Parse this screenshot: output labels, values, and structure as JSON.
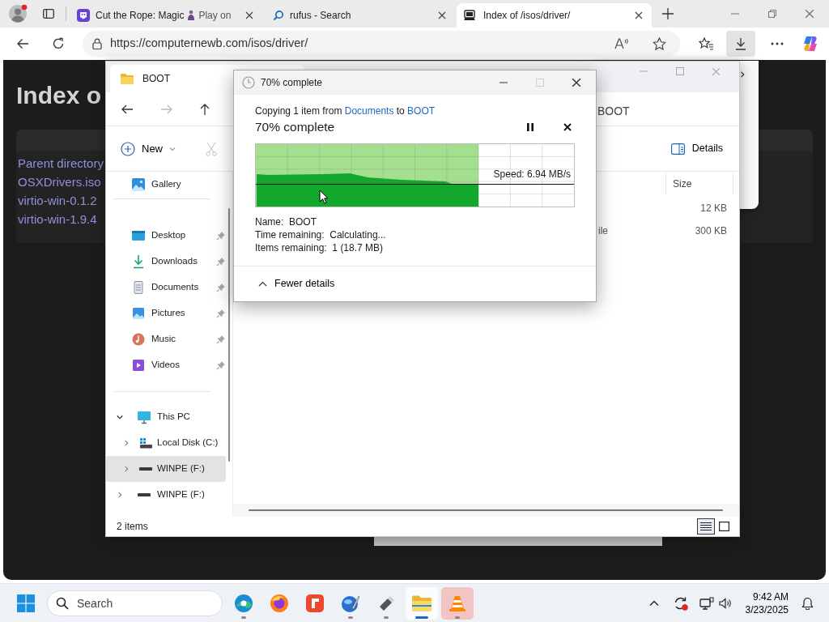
{
  "browser": {
    "tabs": [
      {
        "title": "Cut the Rope: Magic",
        "title_after_icon": "Play on",
        "selected": false
      },
      {
        "title": "rufus - Search",
        "selected": false
      },
      {
        "title": "Index of /isos/driver/",
        "selected": true
      }
    ],
    "address": "https://computernewb.com/isos/driver/"
  },
  "web_page": {
    "heading": "Index o",
    "links": [
      "Parent directory",
      "OSXDrivers.iso",
      "virtio-win-0.1.2",
      "virtio-win-1.9.4"
    ]
  },
  "explorer": {
    "tab_title": "BOOT",
    "breadcrumb": "BOOT",
    "new_label": "New",
    "cut_disabled": true,
    "details_label": "Details",
    "sidebar": {
      "top": [
        {
          "label": "Gallery"
        }
      ],
      "quick_access": [
        {
          "label": "Desktop",
          "pinned": true
        },
        {
          "label": "Downloads",
          "pinned": true
        },
        {
          "label": "Documents",
          "pinned": true
        },
        {
          "label": "Pictures",
          "pinned": true
        },
        {
          "label": "Music",
          "pinned": true
        },
        {
          "label": "Videos",
          "pinned": true
        }
      ],
      "tree": [
        {
          "label": "This PC",
          "expanded": true,
          "selected": false,
          "children": [
            {
              "label": "Local Disk (C:)",
              "expanded": false,
              "selected": false
            },
            {
              "label": "WINPE (F:)",
              "expanded": false,
              "selected": true
            }
          ]
        },
        {
          "label": "WINPE (F:)",
          "expanded": false,
          "selected": false
        }
      ]
    },
    "columns": [
      "Size"
    ],
    "rows": [
      {
        "size": "12 KB"
      },
      {
        "type": "ile",
        "size": "300 KB"
      }
    ],
    "status": "2 items",
    "views": [
      {
        "selected": true
      },
      {
        "selected": false
      }
    ]
  },
  "dialog": {
    "title": "70% complete",
    "maximize_disabled": true,
    "copy_prefix": "Copying 1 item from",
    "source": "Documents",
    "joiner": "to",
    "destination": "BOOT",
    "heading": "70% complete",
    "progress": {
      "level": 0.7,
      "speed": "Speed: 6.94 MB/s"
    },
    "details": [
      {
        "label": "Name:",
        "value": "BOOT"
      },
      {
        "label": "Time remaining:",
        "value": "Calculating..."
      },
      {
        "label": "Items remaining:",
        "value": "1 (18.7 MB)"
      }
    ],
    "toggle": "Fewer details"
  },
  "taskbar": {
    "search_placeholder": "Search",
    "apps": [
      {
        "running": true,
        "selected": false,
        "highlighted": false
      },
      {
        "running": false,
        "selected": false,
        "highlighted": false
      },
      {
        "running": false,
        "selected": false,
        "highlighted": false
      },
      {
        "running": true,
        "selected": false,
        "highlighted": false
      },
      {
        "running": true,
        "selected": false,
        "highlighted": false
      },
      {
        "running": true,
        "selected": true,
        "highlighted": false
      },
      {
        "running": true,
        "selected": false,
        "highlighted": true
      }
    ],
    "time": "9:42 AM",
    "date": "3/23/2025"
  }
}
